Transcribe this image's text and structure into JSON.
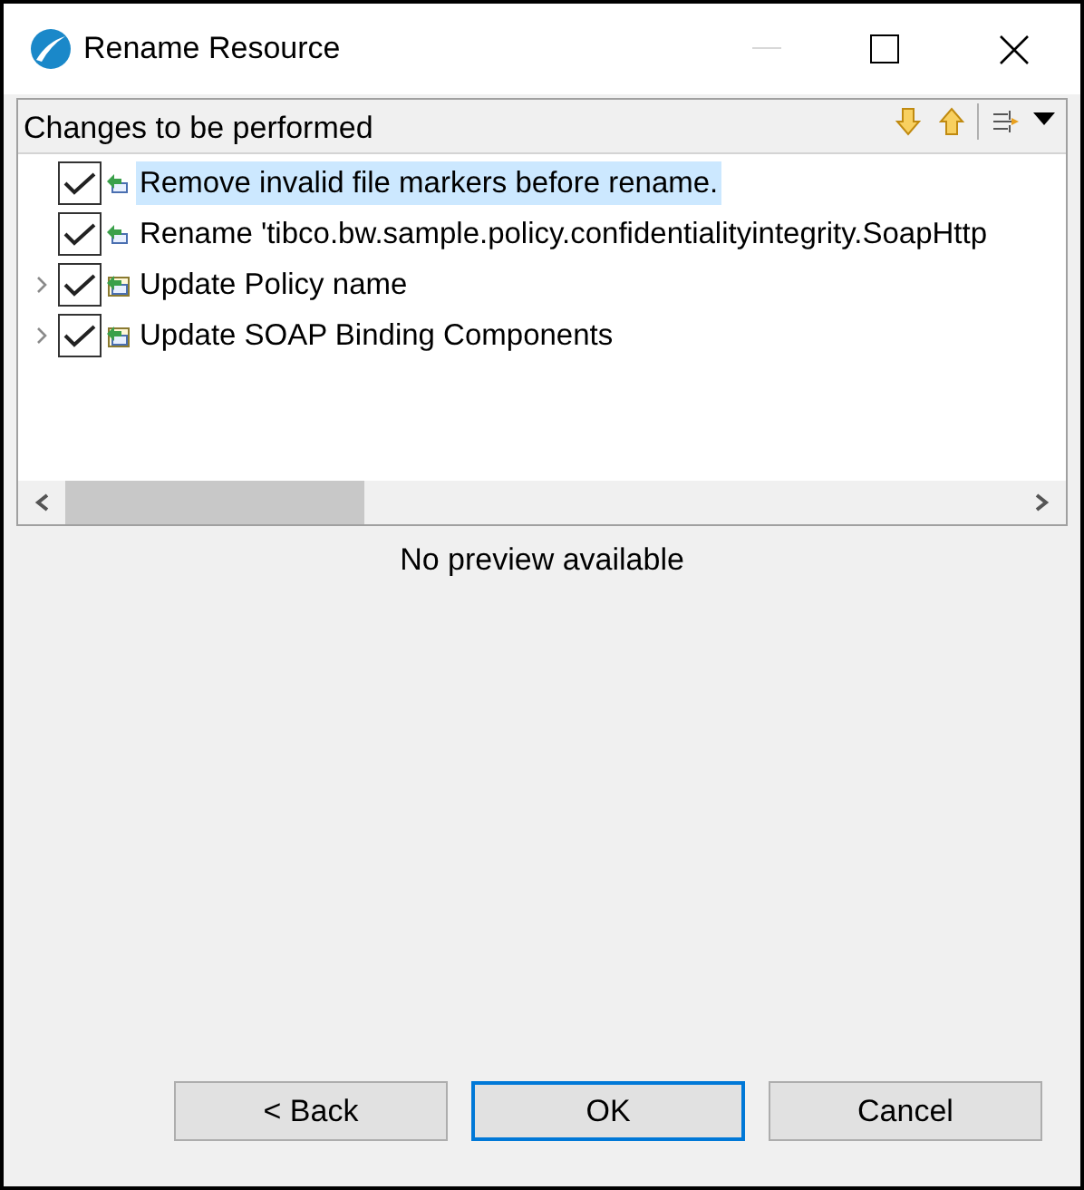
{
  "window": {
    "title": "Rename Resource"
  },
  "changes": {
    "title": "Changes to be performed",
    "items": [
      {
        "kind": "change",
        "label": "Remove invalid file markers before rename.",
        "checked": true,
        "selected": true
      },
      {
        "kind": "change",
        "label": "Rename 'tibco.bw.sample.policy.confidentialityintegrity.SoapHttp",
        "checked": true,
        "selected": false
      },
      {
        "kind": "group",
        "label": "Update Policy name",
        "checked": true,
        "selected": false,
        "expanded": false
      },
      {
        "kind": "group",
        "label": "Update SOAP Binding Components",
        "checked": true,
        "selected": false,
        "expanded": false
      }
    ]
  },
  "preview": {
    "message": "No preview available"
  },
  "buttons": [
    {
      "label": "< Back",
      "default": false
    },
    {
      "label": "OK",
      "default": true
    },
    {
      "label": "Cancel",
      "default": false
    }
  ]
}
